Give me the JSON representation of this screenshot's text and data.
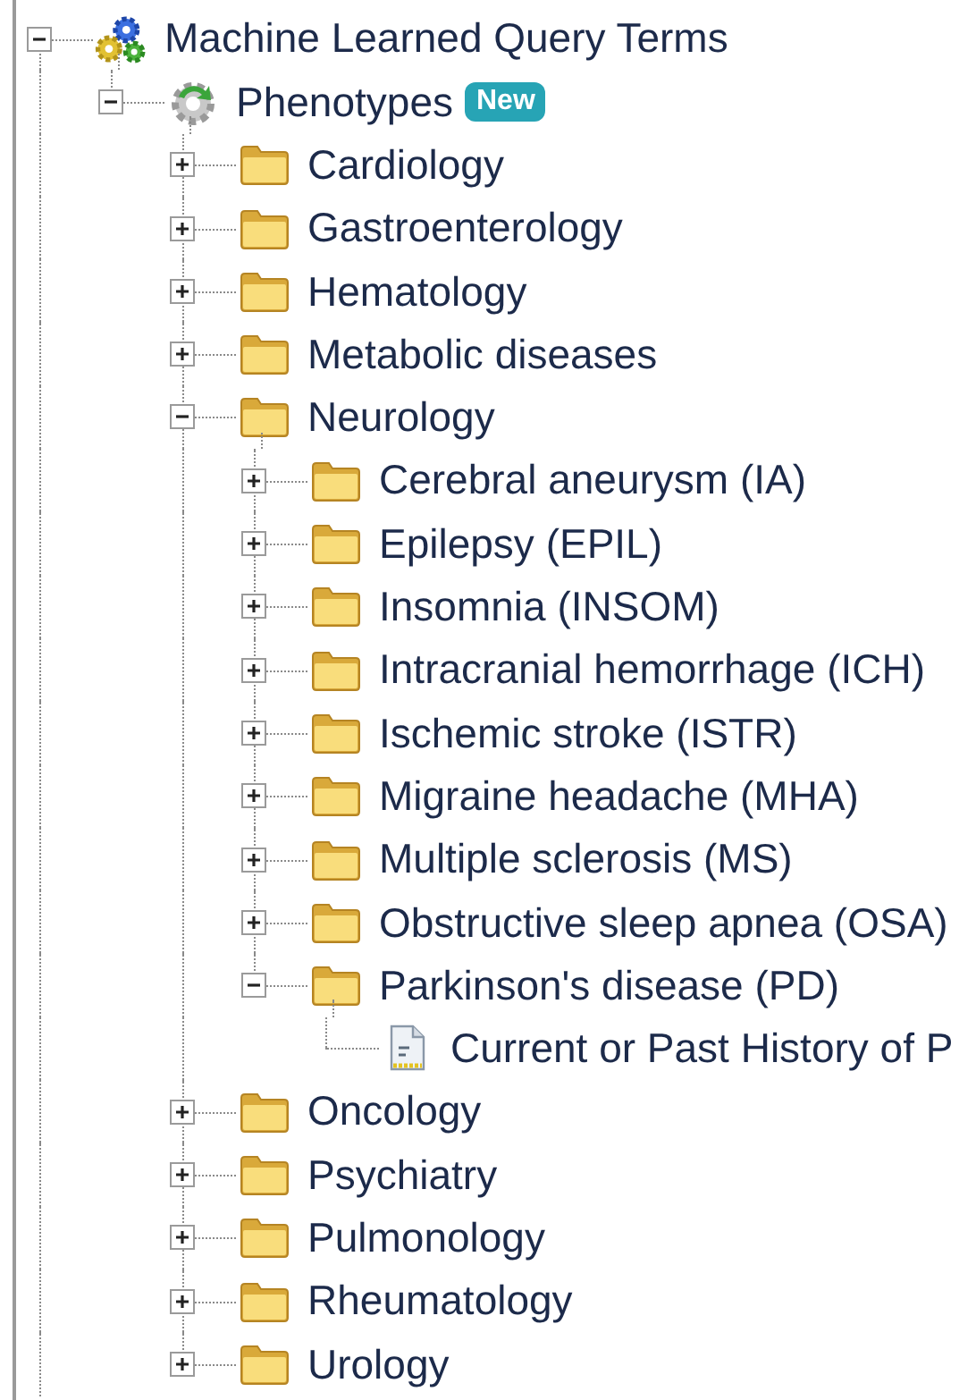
{
  "tree": [
    {
      "label": "Machine Learned Query Terms",
      "kind": "gears",
      "expanded": true,
      "children": [
        {
          "label": "Phenotypes",
          "kind": "gear",
          "badge": "New",
          "expanded": true,
          "children": [
            {
              "label": "Cardiology",
              "kind": "folder",
              "expanded": false
            },
            {
              "label": "Gastroenterology",
              "kind": "folder",
              "expanded": false
            },
            {
              "label": "Hematology",
              "kind": "folder",
              "expanded": false
            },
            {
              "label": "Metabolic diseases",
              "kind": "folder",
              "expanded": false
            },
            {
              "label": "Neurology",
              "kind": "folder",
              "expanded": true,
              "children": [
                {
                  "label": "Cerebral aneurysm (IA)",
                  "kind": "folder",
                  "expanded": false
                },
                {
                  "label": "Epilepsy (EPIL)",
                  "kind": "folder",
                  "expanded": false
                },
                {
                  "label": "Insomnia (INSOM)",
                  "kind": "folder",
                  "expanded": false
                },
                {
                  "label": "Intracranial hemorrhage (ICH)",
                  "kind": "folder",
                  "expanded": false
                },
                {
                  "label": "Ischemic stroke (ISTR)",
                  "kind": "folder",
                  "expanded": false
                },
                {
                  "label": "Migraine headache (MHA)",
                  "kind": "folder",
                  "expanded": false
                },
                {
                  "label": "Multiple sclerosis (MS)",
                  "kind": "folder",
                  "expanded": false
                },
                {
                  "label": "Obstructive sleep apnea (OSA)",
                  "kind": "folder",
                  "expanded": false
                },
                {
                  "label": "Parkinson's disease (PD)",
                  "kind": "folder",
                  "expanded": true,
                  "children": [
                    {
                      "label": "Current or Past History of P",
                      "kind": "document"
                    }
                  ]
                }
              ]
            },
            {
              "label": "Oncology",
              "kind": "folder",
              "expanded": false
            },
            {
              "label": "Psychiatry",
              "kind": "folder",
              "expanded": false
            },
            {
              "label": "Pulmonology",
              "kind": "folder",
              "expanded": false
            },
            {
              "label": "Rheumatology",
              "kind": "folder",
              "expanded": false
            },
            {
              "label": "Urology",
              "kind": "folder",
              "expanded": false
            }
          ]
        }
      ]
    }
  ]
}
